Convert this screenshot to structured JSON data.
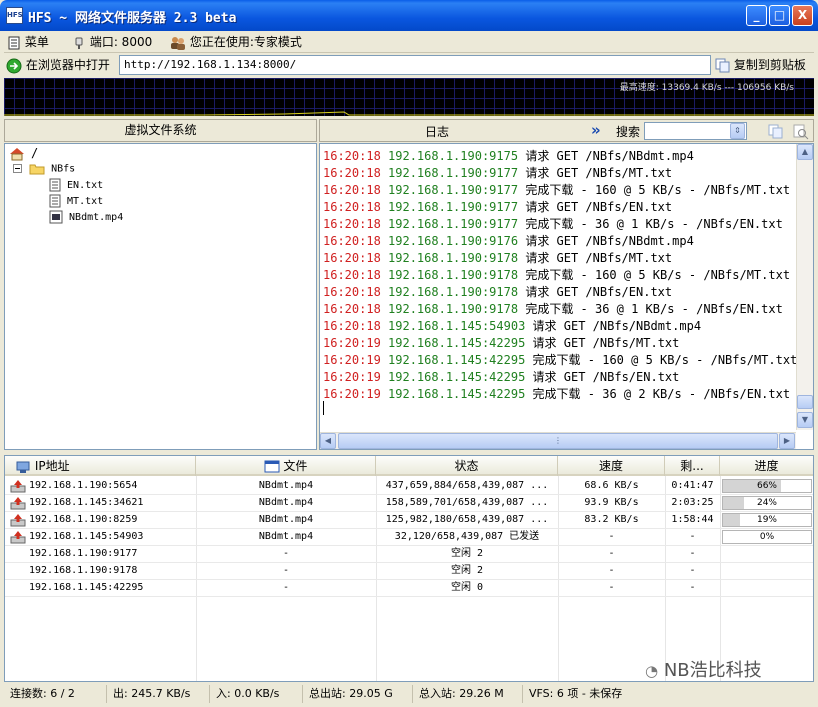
{
  "window": {
    "title": "HFS ~ 网络文件服务器 2.3 beta",
    "icon_label": "HFS",
    "minimize": "_",
    "maximize": "□",
    "close": "X"
  },
  "toolbar": {
    "menu": "菜单",
    "port": "端口: 8000",
    "mode": "您正在使用:专家模式"
  },
  "urlbar": {
    "open_browser": "在浏览器中打开",
    "url": "http://192.168.1.134:8000/",
    "copy_clipboard": "复制到剪贴板"
  },
  "graph": {
    "text": "最高速度: 13369.4 KB/s --- 106956 KB/s"
  },
  "vfs": {
    "header": "虚拟文件系统",
    "root": "/",
    "folder": "NBfs",
    "files": [
      "EN.txt",
      "MT.txt",
      "NBdmt.mp4"
    ]
  },
  "log": {
    "header": "日志",
    "search_label": "搜索",
    "search_value": "",
    "entries": [
      {
        "time": "16:20:18",
        "ip": "192.168.1.190:9175",
        "msg": "请求 GET /NBfs/NBdmt.mp4"
      },
      {
        "time": "16:20:18",
        "ip": "192.168.1.190:9177",
        "msg": "请求 GET /NBfs/MT.txt"
      },
      {
        "time": "16:20:18",
        "ip": "192.168.1.190:9177",
        "msg": "完成下载 - 160 @ 5 KB/s - /NBfs/MT.txt"
      },
      {
        "time": "16:20:18",
        "ip": "192.168.1.190:9177",
        "msg": "请求 GET /NBfs/EN.txt"
      },
      {
        "time": "16:20:18",
        "ip": "192.168.1.190:9177",
        "msg": "完成下载 - 36 @ 1 KB/s - /NBfs/EN.txt"
      },
      {
        "time": "16:20:18",
        "ip": "192.168.1.190:9176",
        "msg": "请求 GET /NBfs/NBdmt.mp4"
      },
      {
        "time": "16:20:18",
        "ip": "192.168.1.190:9178",
        "msg": "请求 GET /NBfs/MT.txt"
      },
      {
        "time": "16:20:18",
        "ip": "192.168.1.190:9178",
        "msg": "完成下载 - 160 @ 5 KB/s - /NBfs/MT.txt"
      },
      {
        "time": "16:20:18",
        "ip": "192.168.1.190:9178",
        "msg": "请求 GET /NBfs/EN.txt"
      },
      {
        "time": "16:20:18",
        "ip": "192.168.1.190:9178",
        "msg": "完成下载 - 36 @ 1 KB/s - /NBfs/EN.txt"
      },
      {
        "time": "16:20:18",
        "ip": "192.168.1.145:54903",
        "msg": "请求 GET /NBfs/NBdmt.mp4"
      },
      {
        "time": "16:20:19",
        "ip": "192.168.1.145:42295",
        "msg": "请求 GET /NBfs/MT.txt"
      },
      {
        "time": "16:20:19",
        "ip": "192.168.1.145:42295",
        "msg": "完成下载 - 160 @ 5 KB/s - /NBfs/MT.txt"
      },
      {
        "time": "16:20:19",
        "ip": "192.168.1.145:42295",
        "msg": "请求 GET /NBfs/EN.txt"
      },
      {
        "time": "16:20:19",
        "ip": "192.168.1.145:42295",
        "msg": "完成下载 - 36 @ 2 KB/s - /NBfs/EN.txt"
      }
    ]
  },
  "connections": {
    "columns": [
      "IP地址",
      "文件",
      "状态",
      "速度",
      "剩...",
      "进度"
    ],
    "rows": [
      {
        "ip": "192.168.1.190:5654",
        "file": "NBdmt.mp4",
        "status": "437,659,884/658,439,087 ...",
        "speed": "68.6 KB/s",
        "remaining": "0:41:47",
        "progress_label": "66%",
        "progress": 0.66,
        "uploading": true
      },
      {
        "ip": "192.168.1.145:34621",
        "file": "NBdmt.mp4",
        "status": "158,589,701/658,439,087 ...",
        "speed": "93.9 KB/s",
        "remaining": "2:03:25",
        "progress_label": "24%",
        "progress": 0.24,
        "uploading": true
      },
      {
        "ip": "192.168.1.190:8259",
        "file": "NBdmt.mp4",
        "status": "125,982,180/658,439,087 ...",
        "speed": "83.2 KB/s",
        "remaining": "1:58:44",
        "progress_label": "19%",
        "progress": 0.19,
        "uploading": true
      },
      {
        "ip": "192.168.1.145:54903",
        "file": "NBdmt.mp4",
        "status": "32,120/658,439,087 已发送",
        "speed": "-",
        "remaining": "-",
        "progress_label": "0%",
        "progress": 0,
        "uploading": true
      },
      {
        "ip": "192.168.1.190:9177",
        "file": "-",
        "status": "空闲 2",
        "speed": "-",
        "remaining": "-",
        "progress_label": "",
        "progress": null,
        "uploading": false
      },
      {
        "ip": "192.168.1.190:9178",
        "file": "-",
        "status": "空闲 2",
        "speed": "-",
        "remaining": "-",
        "progress_label": "",
        "progress": null,
        "uploading": false
      },
      {
        "ip": "192.168.1.145:42295",
        "file": "-",
        "status": "空闲 0",
        "speed": "-",
        "remaining": "-",
        "progress_label": "",
        "progress": null,
        "uploading": false
      }
    ]
  },
  "statusbar": {
    "connections": "连接数: 6 / 2",
    "out": "出: 245.7 KB/s",
    "in": "入: 0.0 KB/s",
    "total_out": "总出站: 29.05 G",
    "total_in": "总入站: 29.26 M",
    "vfs": "VFS: 6 项 - 未保存"
  },
  "watermark": "NB浩比科技",
  "colors": {
    "log_time": "#d02020",
    "log_ip": "#208020",
    "titlebar": "#0a5ee8"
  }
}
